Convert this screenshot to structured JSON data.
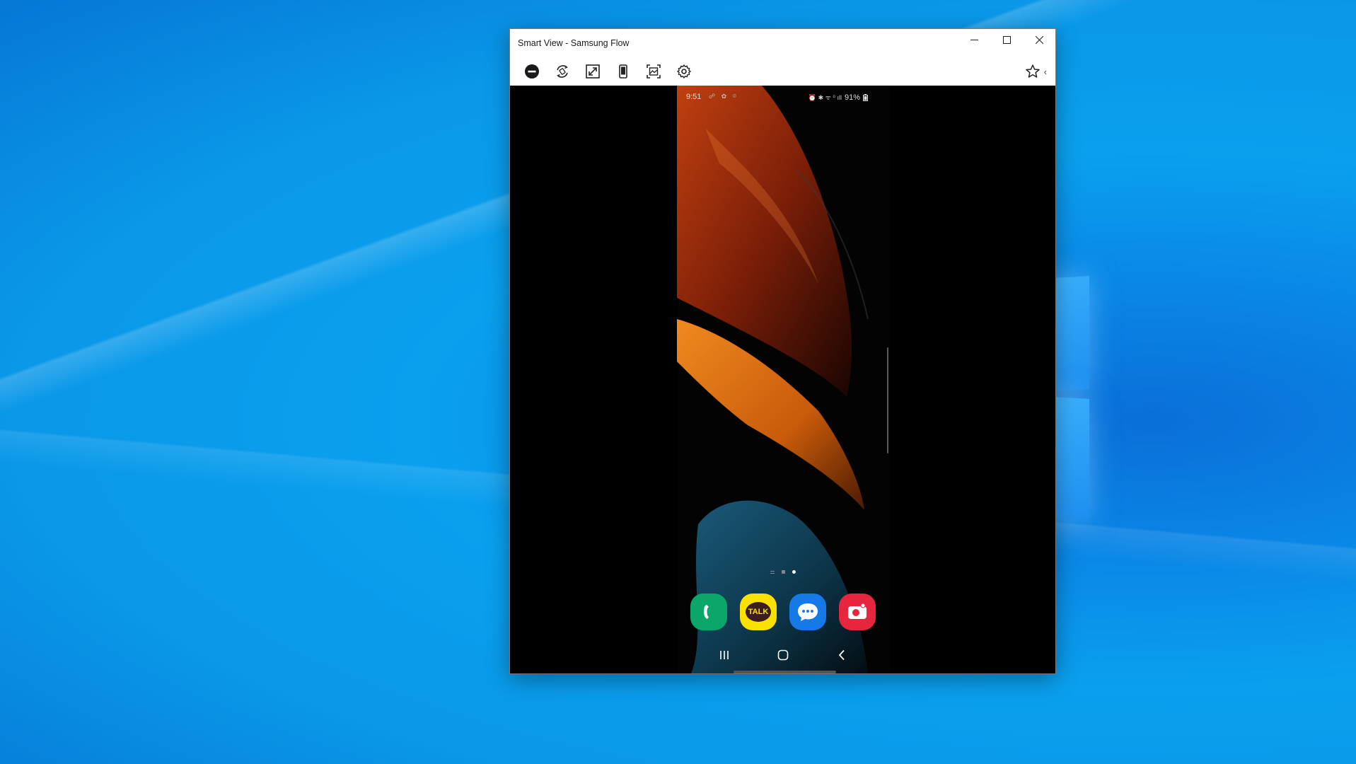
{
  "window": {
    "title": "Smart View - Samsung Flow",
    "controls": [
      "minimize",
      "maximize",
      "close"
    ]
  },
  "toolbar": {
    "icons": [
      "disconnect-icon",
      "rotate-icon",
      "resize-icon",
      "phone-fit-icon",
      "screenshot-icon",
      "settings-icon"
    ],
    "favorite_icon": "star-icon",
    "collapse_glyph": "‹"
  },
  "phone": {
    "status": {
      "time": "9:51",
      "left_icons": "☍ ✿ ⌾",
      "right_icons": "⏰ ✱ ᯤ ⁰ ıll",
      "battery": "91%"
    },
    "page_indicator": {
      "count": 3,
      "active_index": 2
    },
    "dock": [
      {
        "name": "Phone",
        "icon": "phone-icon",
        "color": "#0ba66a"
      },
      {
        "name": "KakaoTalk",
        "icon": "talk-icon",
        "label": "TALK",
        "color": "#fae100"
      },
      {
        "name": "Messages",
        "icon": "messages-icon",
        "color": "#1679e8"
      },
      {
        "name": "Camera",
        "icon": "camera-icon",
        "color": "#e8253e"
      }
    ],
    "nav": [
      "recents-icon",
      "home-icon",
      "back-icon"
    ]
  }
}
